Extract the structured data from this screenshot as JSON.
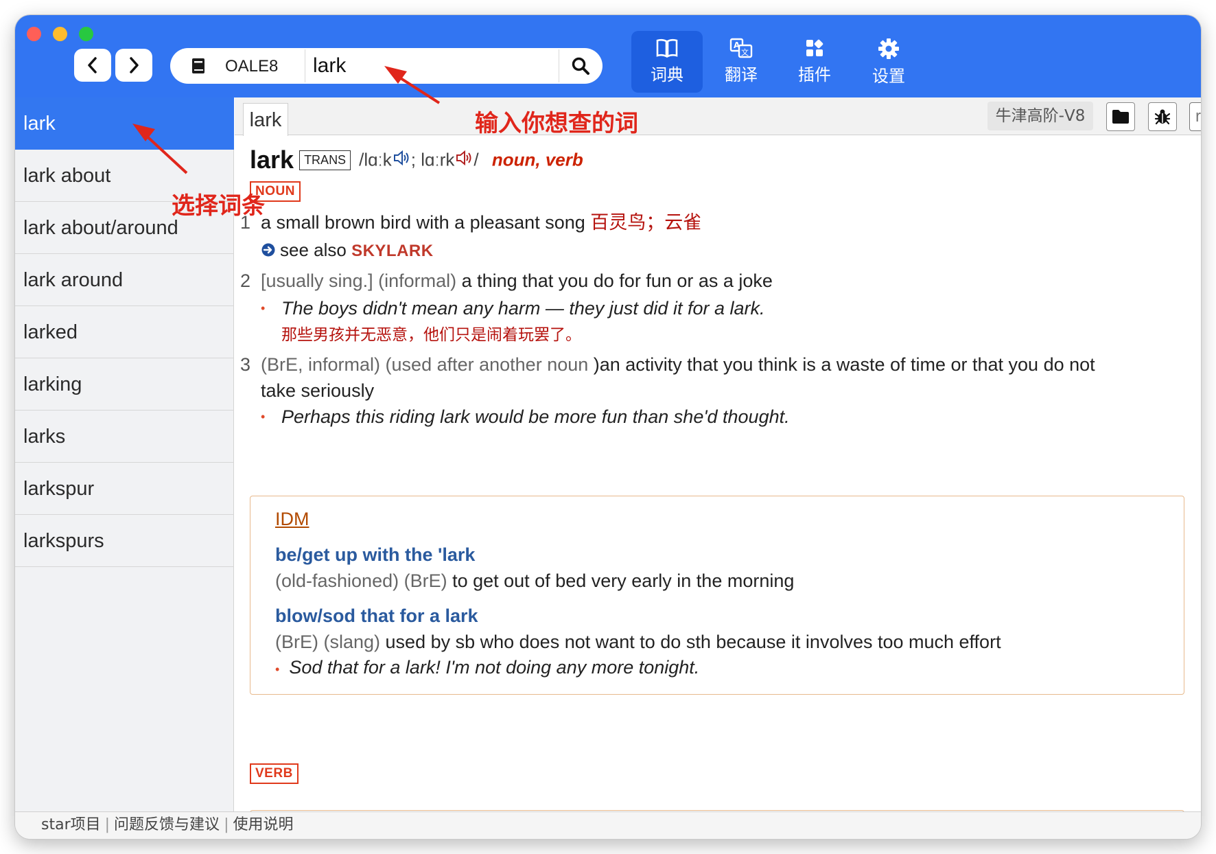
{
  "window": {
    "controls": [
      "close",
      "minimize",
      "zoom"
    ]
  },
  "toolbar": {
    "back_icon": "chevron-left-icon",
    "forward_icon": "chevron-right-icon",
    "search": {
      "dict_name": "OALE8",
      "value": "lark",
      "icon": "search-icon"
    },
    "tabs": [
      {
        "label": "词典",
        "icon": "book-icon",
        "active": true
      },
      {
        "label": "翻译",
        "icon": "translate-icon",
        "active": false
      },
      {
        "label": "插件",
        "icon": "plugin-icon",
        "active": false
      },
      {
        "label": "设置",
        "icon": "gear-icon",
        "active": false
      }
    ],
    "accent": "#3275f2"
  },
  "sidebar": {
    "items": [
      "lark",
      "lark about",
      "lark about/around",
      "lark around",
      "larked",
      "larking",
      "larks",
      "larkspur",
      "larkspurs"
    ],
    "selected": 0
  },
  "content_toolbar": {
    "tab_label": "lark",
    "dict_label": "牛津高阶-V8",
    "resource_placeholder": "resource key..."
  },
  "entry": {
    "headword": "lark",
    "trans_badge": "TRANS",
    "pron_open": "/",
    "pron_br": "lɑːk",
    "pron_sep": "; ",
    "pron_us": "lɑːrk",
    "pron_close": "/",
    "pos_noun": "noun",
    "pos_comma": ", ",
    "pos_verb": "verb",
    "noun_badge": "NOUN",
    "senses": [
      {
        "num": "1",
        "def": "a small brown bird with a pleasant song ",
        "zh": "百灵鸟；云雀",
        "see_also_text": "see also ",
        "see_also_ref": "SKYLARK"
      },
      {
        "num": "2",
        "grammar": "[usually sing.]",
        "label": "(informal)",
        "def": " a thing that you do for fun or as a joke",
        "example": "The boys didn't mean any harm — they just did it for a lark.",
        "example_zh": "那些男孩并无恶意，他们只是闹着玩罢了。"
      },
      {
        "num": "3",
        "label": "(BrE, informal)",
        "label2": "(used after another noun ",
        "def_line1": ")an activity that you think is a waste of time or that you do not",
        "def_line2": "take seriously",
        "example": "Perhaps this riding lark would be more fun than she'd thought."
      }
    ],
    "idioms": {
      "title": "IDM",
      "items": [
        {
          "phrase": "be/get up with the 'lark",
          "labels": "(old-fashioned) (BrE)",
          "def": " to get out of bed very early in the morning"
        },
        {
          "phrase": "blow/sod that for a lark",
          "labels": "(BrE) (slang)",
          "def": " used by sb who does not want to do sth because it involves too much effort",
          "example": "Sod that for a lark! I'm not doing any more tonight."
        }
      ]
    },
    "verb_badge": "VERB"
  },
  "footer": {
    "links": [
      "star项目",
      "问题反馈与建议",
      "使用说明"
    ],
    "separator": "|"
  },
  "annotations": {
    "input_hint": "输入你想查的词",
    "select_hint": "选择词条",
    "color": "#e0261b"
  }
}
